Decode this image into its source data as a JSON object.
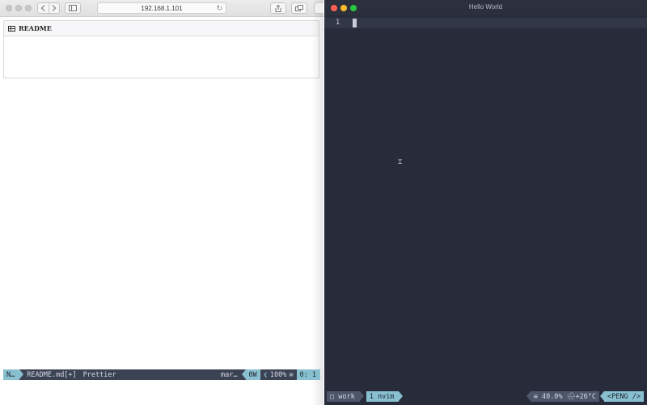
{
  "browser": {
    "url": "192.168.1.101",
    "icons": {
      "back": "chevron-left-icon",
      "forward": "chevron-right-icon",
      "sidebar": "sidebar-icon",
      "reload": "reload-icon",
      "share": "share-icon",
      "tabs": "tabs-icon"
    },
    "readme": {
      "icon": "table-icon",
      "title": "README"
    }
  },
  "terminal": {
    "title": "Hello World",
    "editor": {
      "line_number": "1",
      "ibeam_glyph": "⌶"
    },
    "statusline": {
      "mode": "N…",
      "file": "README.md[+]",
      "formatter": "Prettier",
      "filetype": "mar…",
      "warnings": "0W",
      "percent": "100%",
      "percent_icon": "≡",
      "position": "0:  1"
    },
    "tmux": {
      "session": "▢ work",
      "window": "1 nvim",
      "stats": "≡ 40.0% 🌧+26°C",
      "host": "<PENG />"
    },
    "colors": {
      "background": "#282c3a",
      "accent": "#88c0d0",
      "close": "#ff5f57",
      "minimize": "#febc2e",
      "maximize": "#28c840"
    }
  }
}
